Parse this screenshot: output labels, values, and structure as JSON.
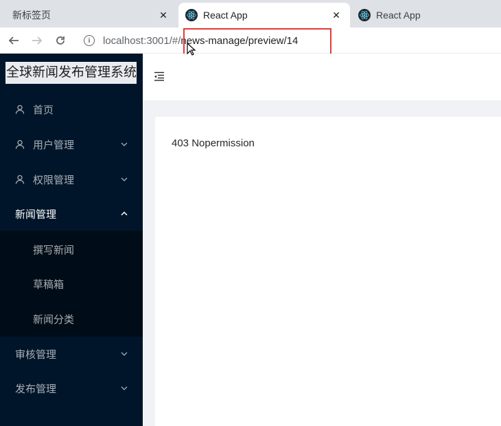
{
  "browser": {
    "tabs": [
      {
        "title": "新标签页",
        "close": "✕"
      },
      {
        "title": "React App",
        "close": "✕"
      },
      {
        "title": "React App"
      }
    ],
    "address": {
      "host": "localhost:3001/#/",
      "path": "news-manage/preview/14"
    }
  },
  "app": {
    "logo": "全球新闻发布管理系统",
    "menu": [
      {
        "label": "首页",
        "icon": "user-icon"
      },
      {
        "label": "用户管理",
        "icon": "user-icon"
      },
      {
        "label": "权限管理",
        "icon": "user-icon"
      },
      {
        "label": "新闻管理"
      },
      {
        "label": "审核管理"
      },
      {
        "label": "发布管理"
      }
    ],
    "news_submenu": [
      {
        "label": "撰写新闻"
      },
      {
        "label": "草稿箱"
      },
      {
        "label": "新闻分类"
      }
    ],
    "content": {
      "message": "403 Nopermission"
    }
  },
  "colors": {
    "sider": "#001529",
    "submenu": "#000c17",
    "layout_bg": "#f0f2f5",
    "highlight": "#e53935"
  }
}
